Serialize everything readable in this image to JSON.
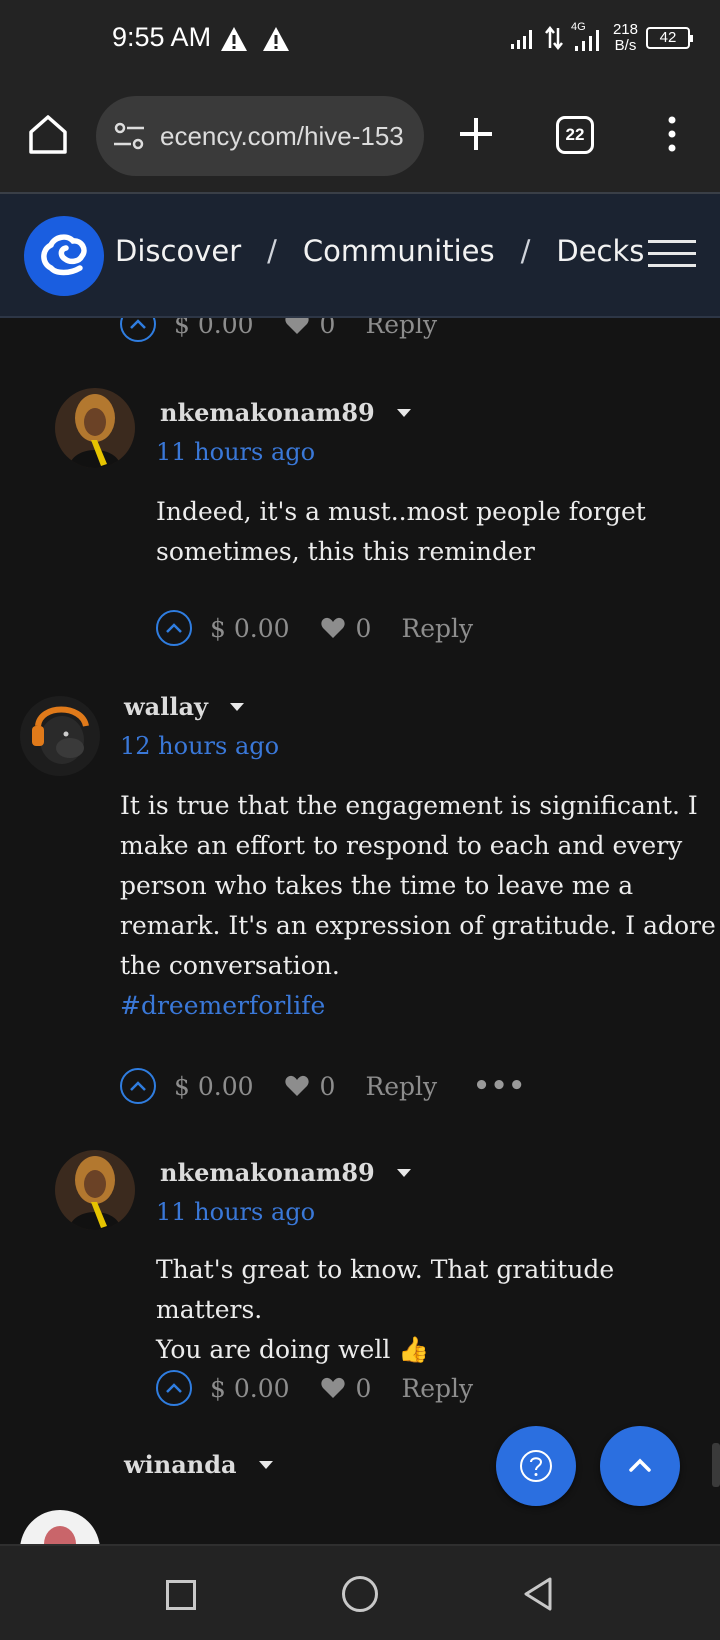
{
  "status_bar": {
    "time": "9:55 AM",
    "network": "4G",
    "speed_value": "218",
    "speed_unit": "B/s",
    "battery": "42"
  },
  "browser": {
    "url": "ecency.com/hive-153",
    "tab_count": "22"
  },
  "site_nav": {
    "links": [
      "Discover",
      "Communities",
      "Decks"
    ],
    "separator": "/"
  },
  "comments": [
    {
      "kind": "actions-only",
      "amount": "$ 0.00",
      "likes": "0",
      "reply_label": "Reply"
    },
    {
      "author": "nkemakonam89",
      "time_ago": "11 hours ago",
      "body_lines": [
        "Indeed, it's a must..most people forget",
        "sometimes, this this reminder"
      ],
      "amount": "$ 0.00",
      "likes": "0",
      "reply_label": "Reply"
    },
    {
      "author": "wallay",
      "time_ago": "12 hours ago",
      "body_lines": [
        "It is true that the engagement is significant. I",
        "make an effort to respond to each and every",
        "person who takes the time to leave me a",
        "remark. It's an expression of gratitude. I adore",
        "the conversation."
      ],
      "hashtag": "#dreemerforlife",
      "amount": "$ 0.00",
      "likes": "0",
      "reply_label": "Reply",
      "more_label": "•••"
    },
    {
      "author": "nkemakonam89",
      "time_ago": "11 hours ago",
      "body_lines": [
        "That's great to know. That gratitude matters.",
        "You are doing well 👍"
      ],
      "amount": "$ 0.00",
      "likes": "0",
      "reply_label": "Reply"
    },
    {
      "author": "winanda"
    }
  ],
  "colors": {
    "accent": "#2b6fe0",
    "link": "#3a78d8",
    "background": "#141414",
    "nav_background": "#1b2331"
  },
  "icons": [
    "home-icon",
    "tune-icon",
    "plus-icon",
    "tab-switcher-icon",
    "overflow-menu-icon",
    "ecency-logo",
    "hamburger-icon",
    "upvote-icon",
    "heart-icon",
    "help-icon",
    "chevron-up-icon",
    "recents-icon",
    "home-circle-icon",
    "back-icon",
    "warning-icon"
  ]
}
